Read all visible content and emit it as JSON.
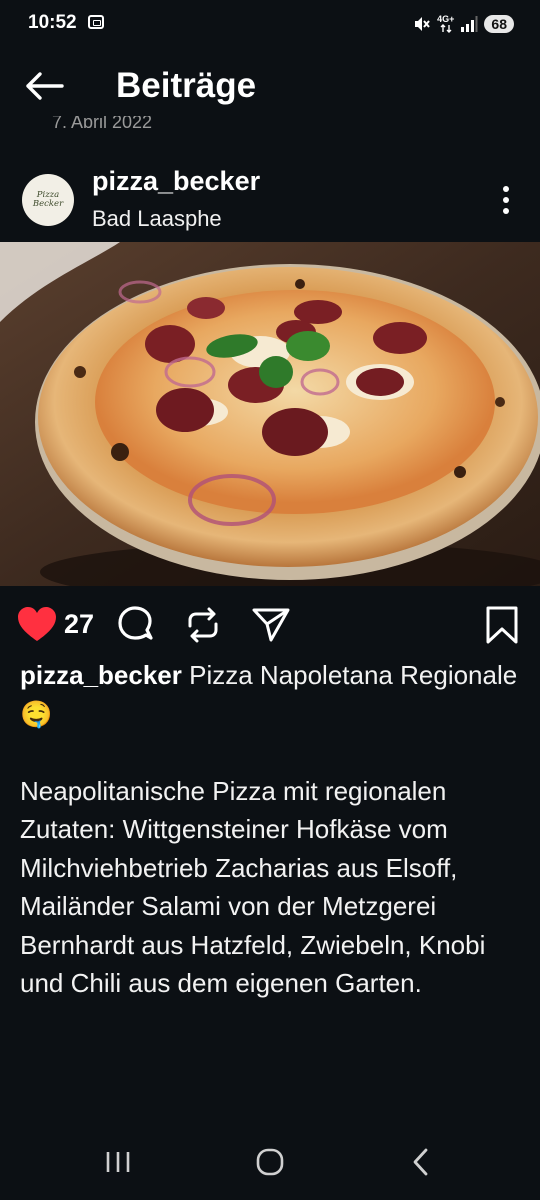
{
  "status_bar": {
    "time": "10:52",
    "network_label": "4G+",
    "battery": "68",
    "icons": [
      "screen-record-icon",
      "mute-icon",
      "data-arrows-icon",
      "signal-icon"
    ]
  },
  "header": {
    "title": "Beiträge",
    "back_icon": "arrow-left-icon",
    "date_partial": "7. April 2022"
  },
  "post": {
    "username": "pizza_becker",
    "location": "Bad Laasphe",
    "avatar_logo_text": "Pizza Becker",
    "image_description_icon": "pizza-photo",
    "likes": "27",
    "caption_title": " Pizza Napoletana Regionale 🤤",
    "caption_body": "Neapolitanische Pizza mit regionalen Zutaten: Wittgensteiner Hofkäse vom Milchviehbetrieb Zacharias aus Elsoff, Mailänder Salami von der Metzgerei Bernhardt aus Hatzfeld, Zwiebeln, Knobi und Chili aus dem eigenen Garten."
  },
  "colors": {
    "background": "#0c1014",
    "like_red": "#ff3040",
    "text": "#f5f5f5"
  },
  "nav_bar": {
    "icons": [
      "recent-apps-icon",
      "home-icon",
      "back-icon"
    ]
  }
}
